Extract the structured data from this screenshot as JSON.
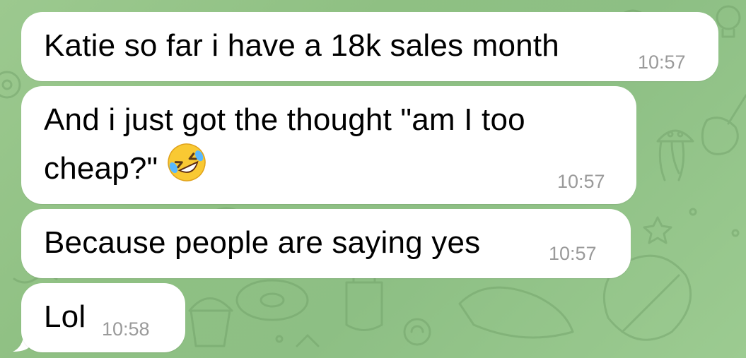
{
  "messages": [
    {
      "text": "Katie so far i have a 18k sales month",
      "time": "10:57"
    },
    {
      "line1": "And i just got the thought \"am I too",
      "line2": "cheap?\"",
      "emoji": "rofl-emoji",
      "time": "10:57"
    },
    {
      "text": "Because people are saying yes",
      "time": "10:57"
    },
    {
      "text": "Lol",
      "time": "10:58"
    }
  ],
  "colors": {
    "background": "#8fc083",
    "bubble": "#ffffff",
    "timestamp": "#9a9a9a",
    "doodle": "#6f9f67"
  }
}
